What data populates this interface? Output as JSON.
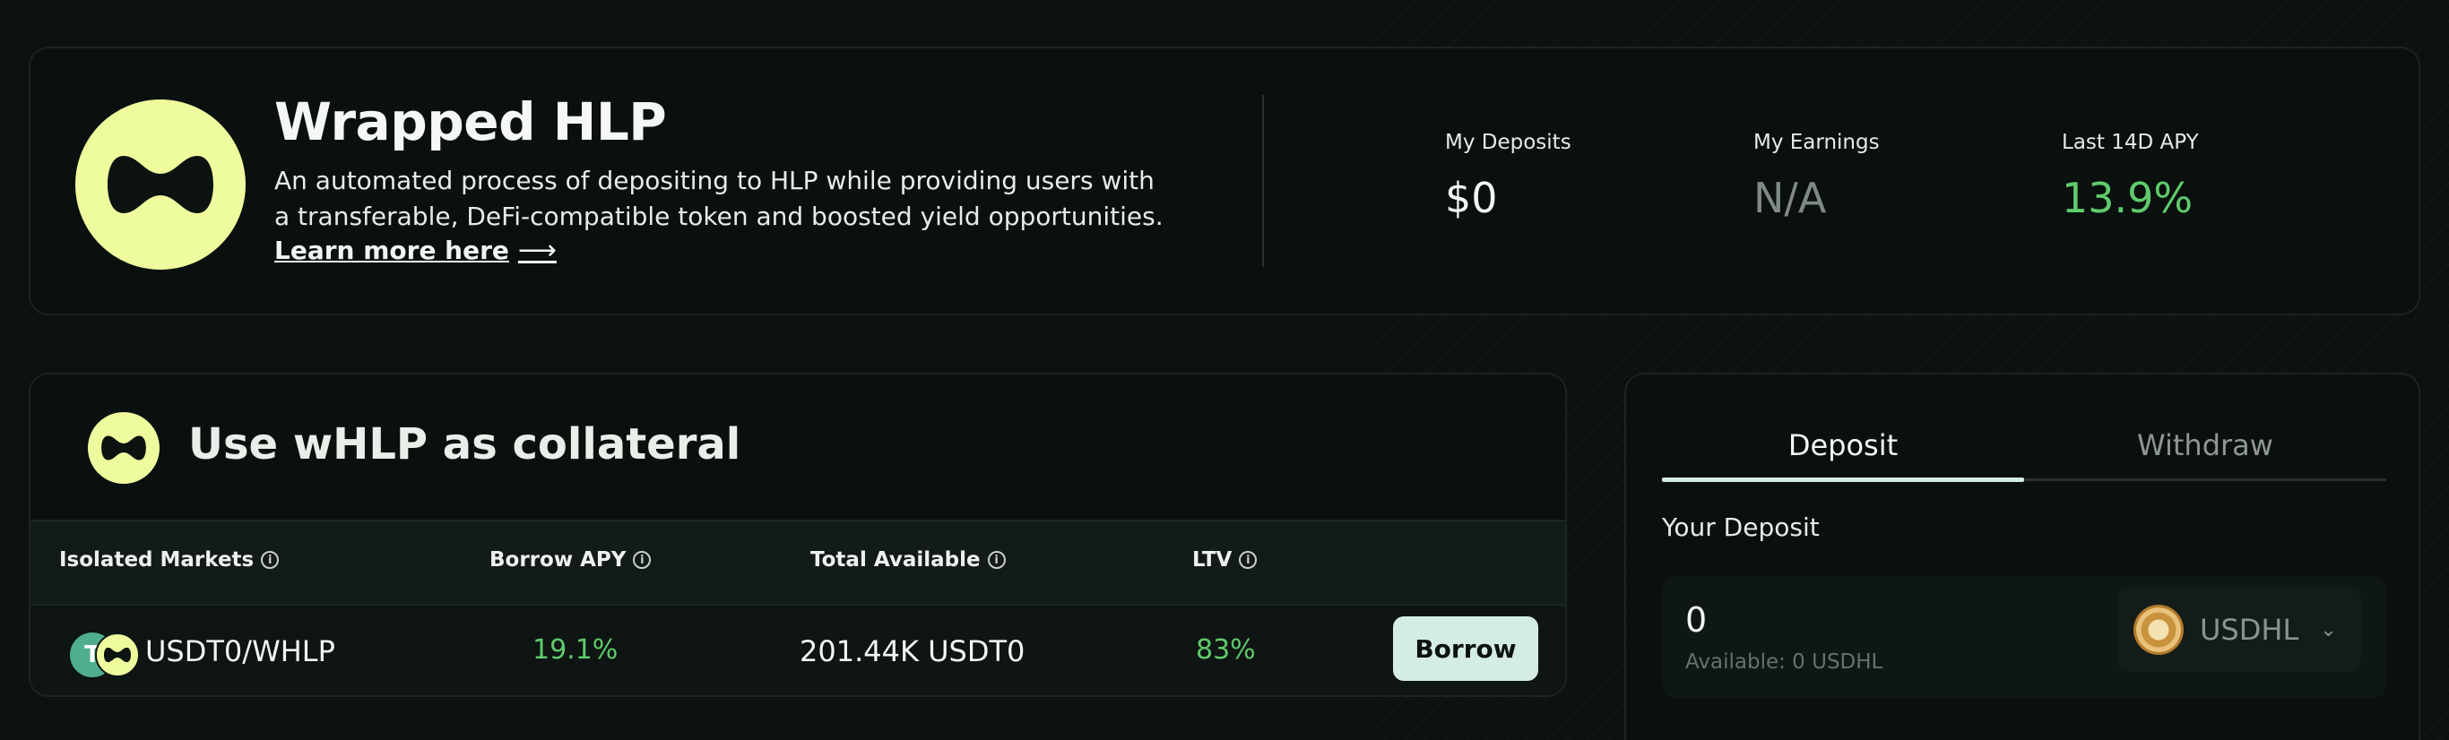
{
  "hero": {
    "title": "Wrapped HLP",
    "description": "An automated process of depositing to HLP while providing users with a transferable, DeFi-compatible token and boosted yield opportunities.",
    "link_label": "Learn more here",
    "link_arrow": "⟶",
    "stats": [
      {
        "label": "My Deposits",
        "value": "$0"
      },
      {
        "label": "My Earnings",
        "value": "N/A"
      },
      {
        "label": "Last 14D APY",
        "value": "13.9%"
      }
    ]
  },
  "collateral": {
    "title": "Use wHLP as collateral",
    "columns": [
      "Isolated Markets",
      "Borrow APY",
      "Total Available",
      "LTV"
    ],
    "info_glyph": "i",
    "rows": [
      {
        "usdt_glyph": "T",
        "pair": "USDT0/WHLP",
        "borrow_apy": "19.1%",
        "total_available": "201.44K USDT0",
        "ltv": "83%",
        "action": "Borrow"
      }
    ]
  },
  "panel": {
    "tabs": [
      {
        "label": "Deposit",
        "active": true
      },
      {
        "label": "Withdraw",
        "active": false
      }
    ],
    "section_label": "Your Deposit",
    "amount": "0",
    "available": "Available: 0 USDHL",
    "token": "USDHL",
    "chevron": "⌄"
  },
  "colors": {
    "background": "#0b1210",
    "accent_yellow": "#eefc9e",
    "positive_green": "#5fcb6b",
    "button_bg": "#d4ece6"
  },
  "icons": [
    "whlp-logo-icon",
    "info-icon",
    "usdt-icon",
    "usdhl-icon",
    "chevron-down-icon",
    "arrow-right-icon"
  ]
}
